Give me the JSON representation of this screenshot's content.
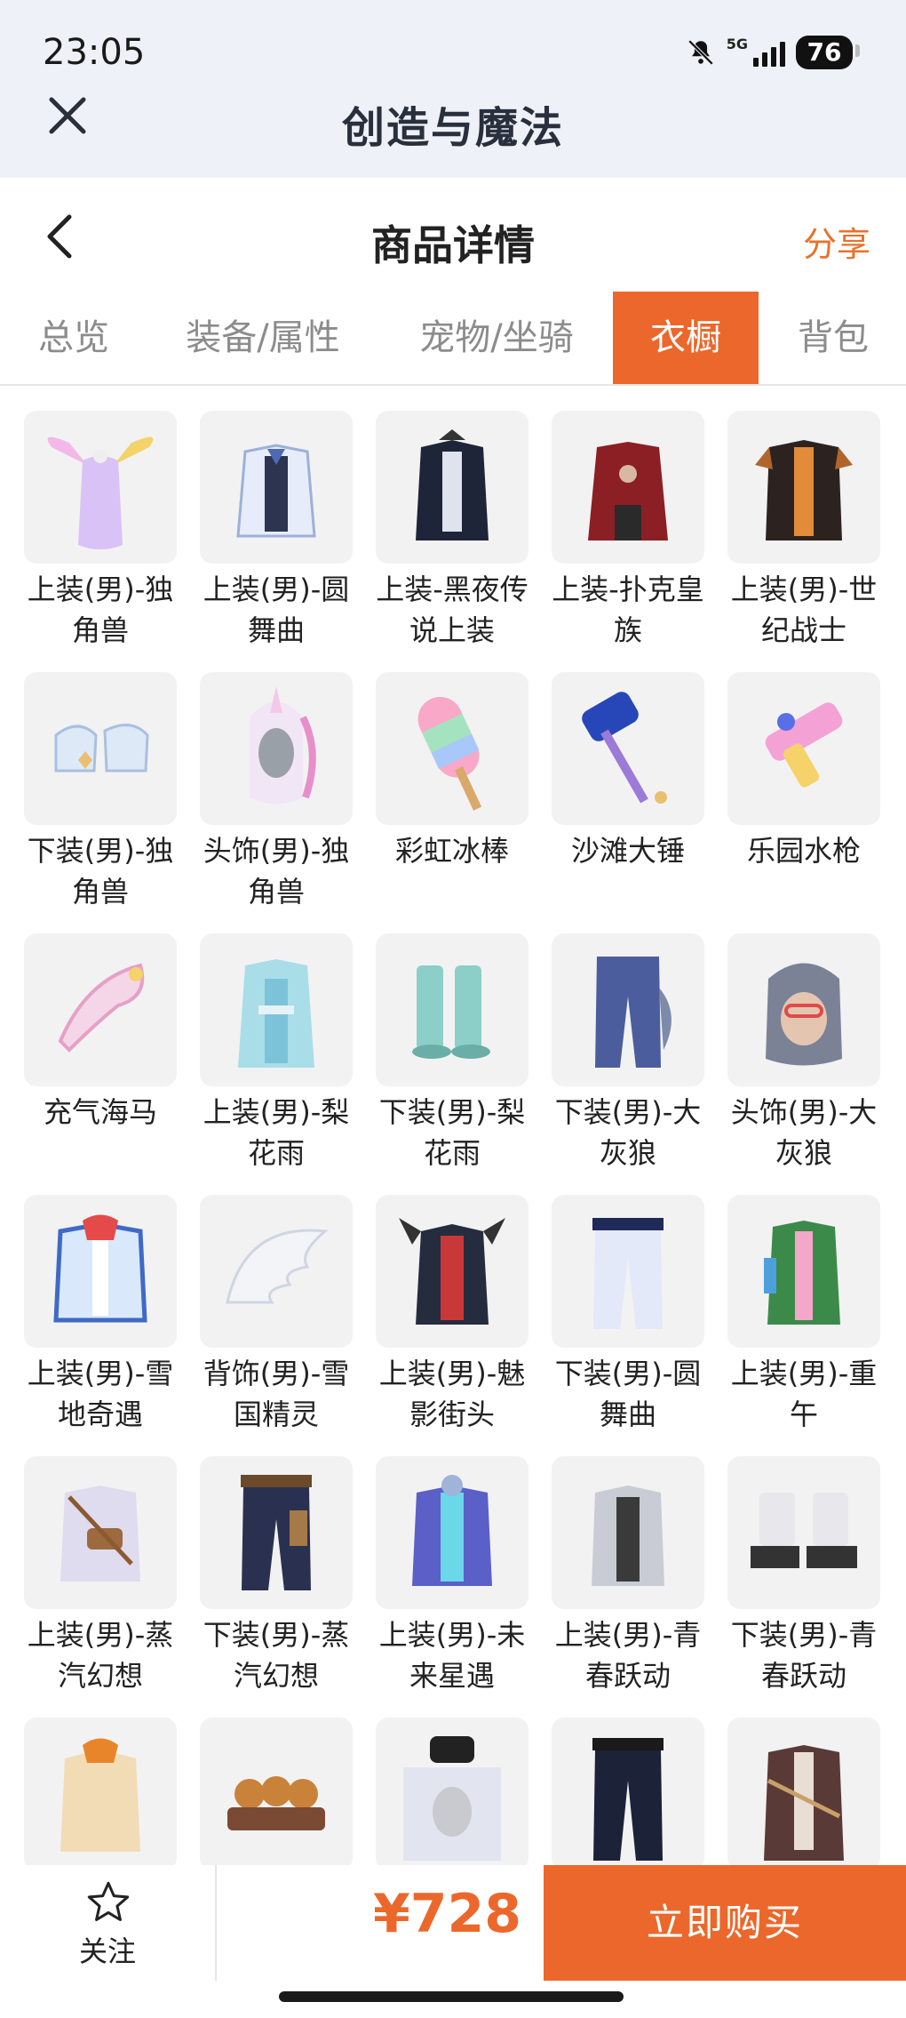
{
  "status_bar": {
    "time": "23:05",
    "network": "5G",
    "battery": "76"
  },
  "app": {
    "title": "创造与魔法"
  },
  "nav": {
    "title": "商品详情",
    "share": "分享"
  },
  "tabs": [
    {
      "label": "总览",
      "active": false
    },
    {
      "label": "装备/属性",
      "active": false
    },
    {
      "label": "宠物/坐骑",
      "active": false
    },
    {
      "label": "衣橱",
      "active": true
    },
    {
      "label": "背包",
      "active": false
    }
  ],
  "wardrobe": {
    "items": [
      {
        "name": "上装(男)-独角兽",
        "icon": "unicorn-top-icon"
      },
      {
        "name": "上装(男)-圆舞曲",
        "icon": "waltz-top-icon"
      },
      {
        "name": "上装-黑夜传说上装",
        "icon": "dark-night-top-icon"
      },
      {
        "name": "上装-扑克皇族",
        "icon": "poker-royal-top-icon"
      },
      {
        "name": "上装(男)-世纪战士",
        "icon": "century-warrior-top-icon"
      },
      {
        "name": "下装(男)-独角兽",
        "icon": "unicorn-bottom-icon"
      },
      {
        "name": "头饰(男)-独角兽",
        "icon": "unicorn-headwear-icon"
      },
      {
        "name": "彩虹冰棒",
        "icon": "rainbow-popsicle-icon"
      },
      {
        "name": "沙滩大锤",
        "icon": "beach-hammer-icon"
      },
      {
        "name": "乐园水枪",
        "icon": "water-gun-icon"
      },
      {
        "name": "充气海马",
        "icon": "inflatable-seahorse-icon"
      },
      {
        "name": "上装(男)-梨花雨",
        "icon": "pear-rain-top-icon"
      },
      {
        "name": "下装(男)-梨花雨",
        "icon": "pear-rain-boots-icon"
      },
      {
        "name": "下装(男)-大灰狼",
        "icon": "wolf-bottom-icon"
      },
      {
        "name": "头饰(男)-大灰狼",
        "icon": "wolf-headwear-icon"
      },
      {
        "name": "上装(男)-雪地奇遇",
        "icon": "snow-top-icon"
      },
      {
        "name": "背饰(男)-雪国精灵",
        "icon": "snow-wings-icon"
      },
      {
        "name": "上装(男)-魅影街头",
        "icon": "phantom-street-top-icon"
      },
      {
        "name": "下装(男)-圆舞曲",
        "icon": "waltz-bottom-icon"
      },
      {
        "name": "上装(男)-重午",
        "icon": "double-fifth-top-icon"
      },
      {
        "name": "上装(男)-蒸汽幻想",
        "icon": "steam-top-icon"
      },
      {
        "name": "下装(男)-蒸汽幻想",
        "icon": "steam-bottom-icon"
      },
      {
        "name": "上装(男)-未来星遇",
        "icon": "future-star-top-icon"
      },
      {
        "name": "上装(男)-青春跃动",
        "icon": "youth-top-icon"
      },
      {
        "name": "下装(男)-青春跃动",
        "icon": "youth-shoes-icon"
      },
      {
        "name": "",
        "icon": "orange-outfit-icon"
      },
      {
        "name": "",
        "icon": "bread-plate-icon"
      },
      {
        "name": "",
        "icon": "veil-headwear-icon"
      },
      {
        "name": "",
        "icon": "dark-pants-icon"
      },
      {
        "name": "",
        "icon": "brown-coat-icon"
      }
    ]
  },
  "bottom": {
    "follow_label": "关注",
    "price": "¥728",
    "buy_label": "立即购买"
  },
  "colors": {
    "accent": "#ec672b",
    "tab_inactive": "#8c8c8c",
    "header_bg": "#eef2f8"
  }
}
